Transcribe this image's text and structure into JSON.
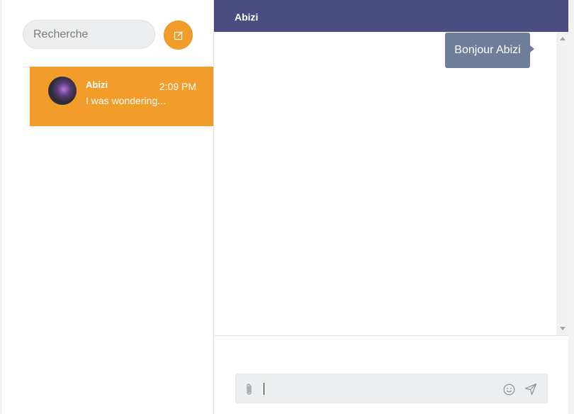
{
  "sidebar": {
    "search": {
      "placeholder": "Recherche"
    },
    "compose_icon": "edit-icon",
    "conversations": [
      {
        "name": "Abizi",
        "time": "2:09 PM",
        "preview": "I was wondering..."
      }
    ]
  },
  "chat": {
    "header_title": "Abizi",
    "messages": [
      {
        "text": "Bonjour Abizi",
        "direction": "outgoing"
      }
    ],
    "composer": {
      "placeholder": "",
      "icons": [
        "paperclip-icon",
        "emoji-icon",
        "send-icon"
      ]
    }
  },
  "colors": {
    "accent": "#f29c2a",
    "header": "#4a4d80",
    "bubble": "#6e7d98"
  }
}
